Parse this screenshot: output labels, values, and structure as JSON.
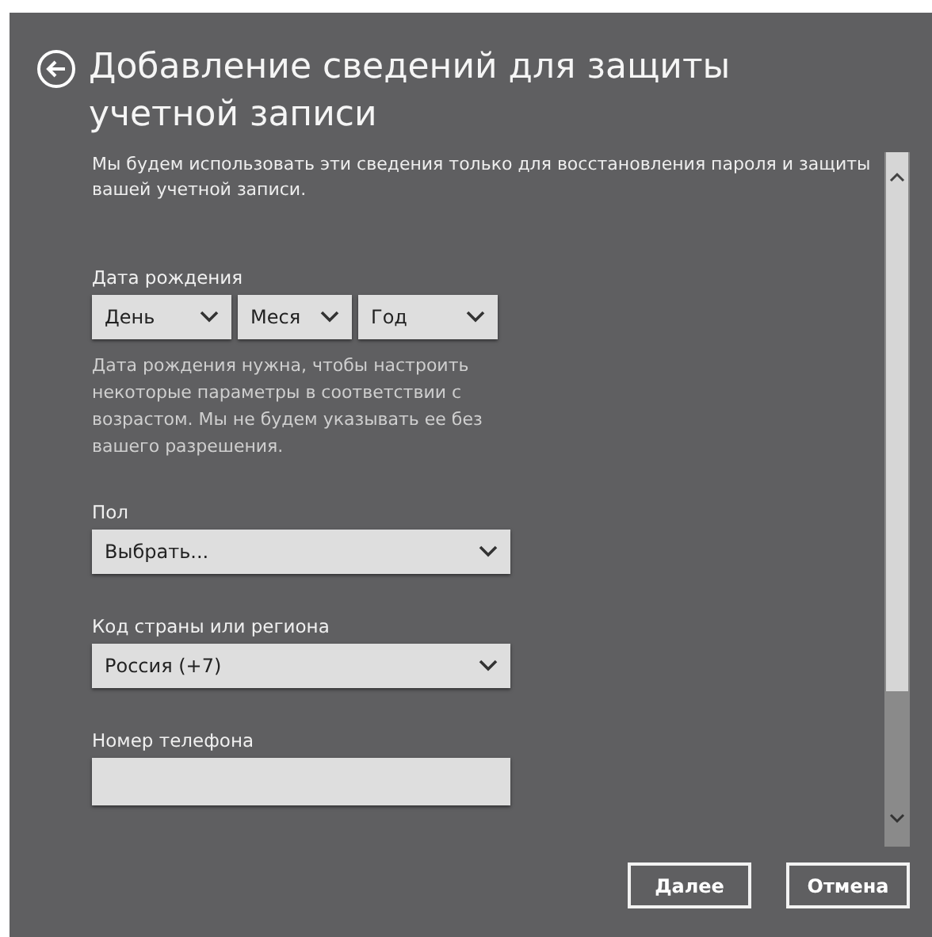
{
  "title": "Добавление сведений для защиты учетной записи",
  "description": "Мы будем использовать эти сведения только для восстановления пароля и защиты вашей учетной записи.",
  "fields": [
    {
      "kind": "date",
      "label": "Дата рождения",
      "parts": [
        "День",
        "Меся",
        "Год"
      ],
      "hint": "Дата рождения нужна, чтобы настроить некоторые параметры в соответствии с возрастом. Мы не будем указывать ее без вашего разрешения."
    },
    {
      "kind": "select",
      "label": "Пол",
      "value": "Выбрать..."
    },
    {
      "kind": "select",
      "label": "Код страны или региона",
      "value": "Россия (+7)"
    },
    {
      "kind": "text",
      "label": "Номер телефона"
    }
  ],
  "buttons": [
    "Далее",
    "Отмена"
  ]
}
